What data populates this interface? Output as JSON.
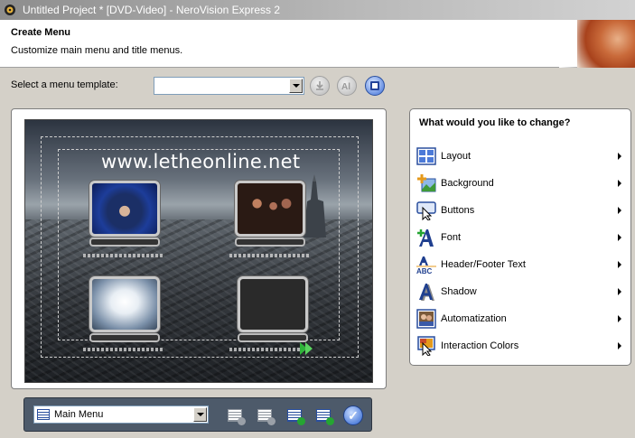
{
  "window": {
    "title": "Untitled Project * [DVD-Video] - NeroVision Express 2",
    "icon": "app-icon"
  },
  "header": {
    "title": "Create Menu",
    "subtitle": "Customize main menu and title menus."
  },
  "template": {
    "label": "Select a menu template:",
    "value": ""
  },
  "preview": {
    "site_title": "www.letheonline.net"
  },
  "bottom_bar": {
    "menu_select_value": "Main Menu"
  },
  "change_panel": {
    "title": "What would you like to change?",
    "items": [
      {
        "label": "Layout",
        "icon": "layout-icon"
      },
      {
        "label": "Background",
        "icon": "background-icon"
      },
      {
        "label": "Buttons",
        "icon": "buttons-icon"
      },
      {
        "label": "Font",
        "icon": "font-icon"
      },
      {
        "label": "Header/Footer Text",
        "icon": "header-footer-text-icon"
      },
      {
        "label": "Shadow",
        "icon": "shadow-icon"
      },
      {
        "label": "Automatization",
        "icon": "automatization-icon"
      },
      {
        "label": "Interaction Colors",
        "icon": "interaction-colors-icon"
      }
    ]
  },
  "colors": {
    "accent_blue": "#2a4f9e",
    "green": "#25a532",
    "bottom_bar": "#4d5a6a"
  }
}
